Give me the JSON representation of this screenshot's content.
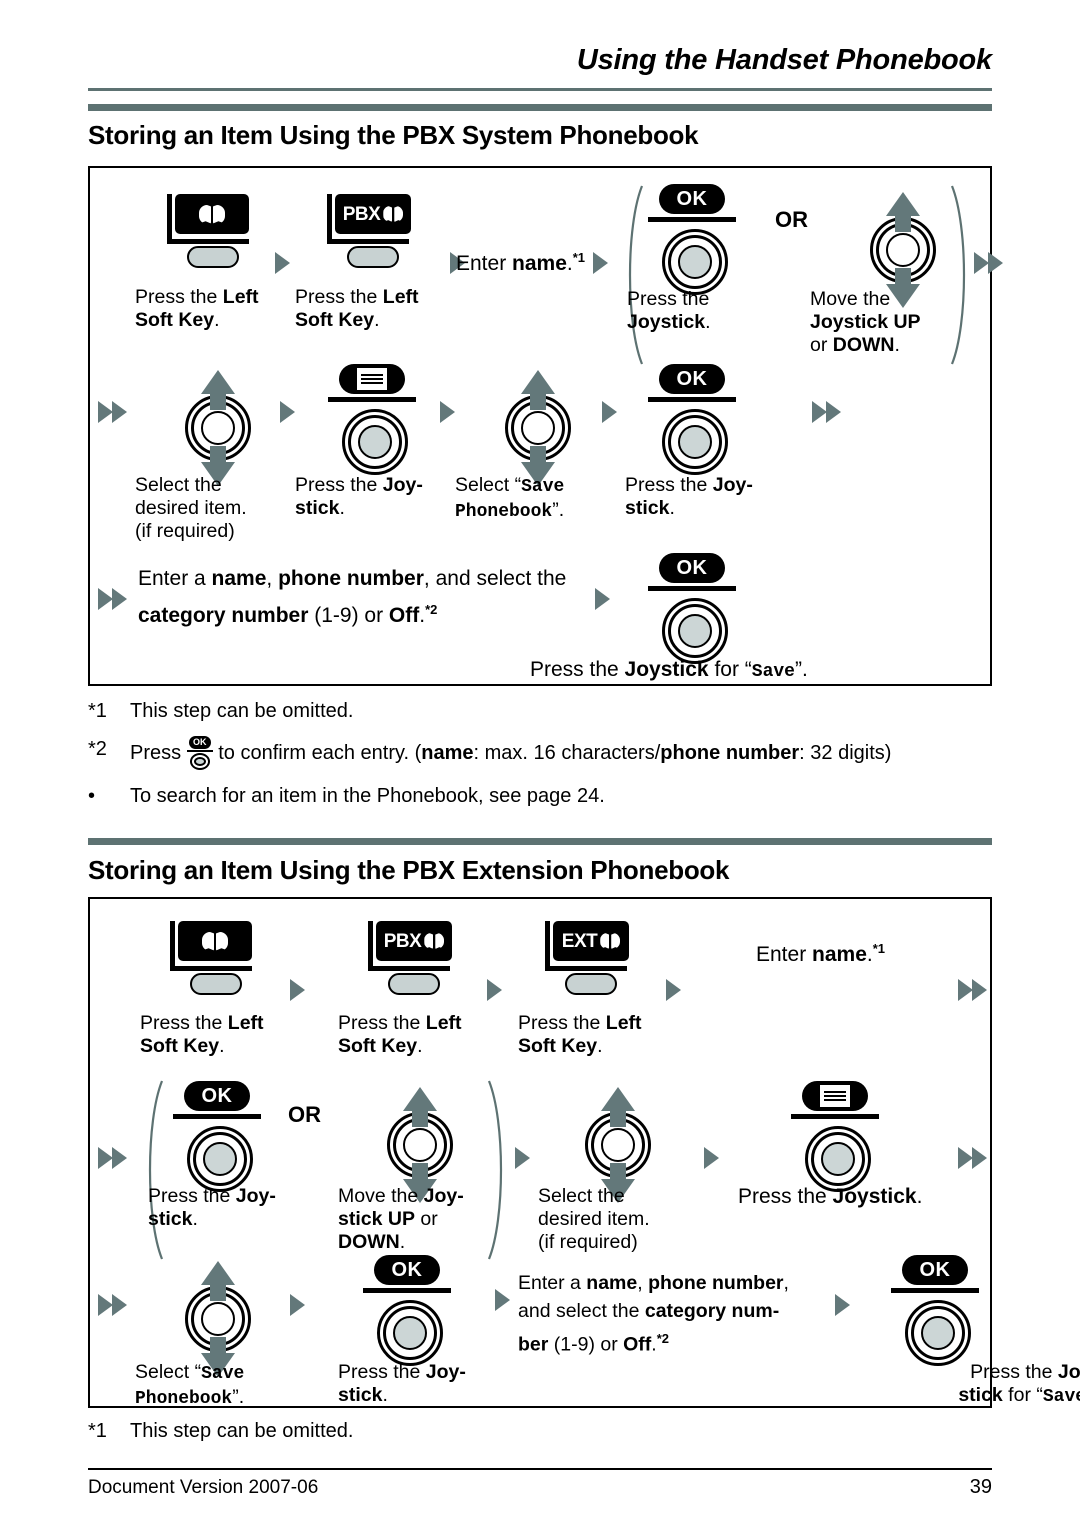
{
  "header": {
    "running_head": "Using the Handset Phonebook"
  },
  "sections": [
    {
      "title": "Storing an Item Using the PBX System Phonebook",
      "steps": [
        {
          "icon": "softkey-phonebook",
          "icon_label": "",
          "caption_html": "Press the <b>Left<br>Soft Key</b>."
        },
        {
          "icon": "softkey-pbx-phonebook",
          "icon_label": "PBX",
          "caption_html": "Press the <b>Left<br>Soft Key</b>."
        },
        {
          "icon": "text",
          "caption_html": "Enter <b>name</b>.<span class=\"sup\">*1</span>"
        },
        {
          "icon": "joystick-ok",
          "caption_html": "Press the<br><b>Joystick</b>."
        },
        {
          "icon": "or-label",
          "caption_html": "OR"
        },
        {
          "icon": "joystick-updown",
          "caption_html": "Move the<br><b>Joystick UP</b><br>or <b>DOWN</b>."
        },
        {
          "icon": "joystick-updown",
          "caption_html": "Select the<br>desired item.<br>(if required)"
        },
        {
          "icon": "joystick-menu",
          "caption_html": "Press the <b>Joy-<br>stick</b>."
        },
        {
          "icon": "joystick-updown",
          "caption_html": "Select “<span class=\"mono\">Save<br>Phonebook</span>”."
        },
        {
          "icon": "joystick-ok",
          "caption_html": "Press the <b>Joy-<br>stick</b>."
        },
        {
          "icon": "text",
          "caption_html": "Enter a <b>name</b>, <b>phone number</b>, and select the<br><b>category number</b> (1-9) or <b>Off</b>.<span class=\"sup\">*2</span>"
        },
        {
          "icon": "joystick-ok",
          "caption_html": "Press the <b>Joystick</b> for “<span class=\"mono\">Save</span>”."
        }
      ],
      "footnotes": [
        {
          "mark": "*1",
          "text": "This step can be omitted."
        },
        {
          "mark": "*2",
          "text_before": "Press ",
          "text_after": " to confirm each entry. (name: max. 16 characters/phone number: 32 digits)"
        },
        {
          "mark": "•",
          "text": "To search for an item in the Phonebook, see page 24."
        }
      ]
    },
    {
      "title": "Storing an Item Using the PBX Extension Phonebook",
      "steps": [
        {
          "icon": "softkey-phonebook",
          "caption_html": "Press the <b>Left<br>Soft Key</b>."
        },
        {
          "icon": "softkey-pbx-phonebook",
          "icon_label": "PBX",
          "caption_html": "Press the <b>Left<br>Soft Key</b>."
        },
        {
          "icon": "softkey-ext-phonebook",
          "icon_label": "EXT",
          "caption_html": "Press the <b>Left<br>Soft Key</b>."
        },
        {
          "icon": "text",
          "caption_html": "Enter <b>name</b>.<span class=\"sup\">*1</span>"
        },
        {
          "icon": "joystick-ok",
          "caption_html": "Press the <b>Joy-<br>stick</b>."
        },
        {
          "icon": "or-label",
          "caption_html": "OR"
        },
        {
          "icon": "joystick-updown",
          "caption_html": "Move the <b>Joy-<br>stick UP</b> or<br><b>DOWN</b>."
        },
        {
          "icon": "joystick-updown",
          "caption_html": "Select the<br>desired item.<br>(if required)"
        },
        {
          "icon": "joystick-menu",
          "caption_html": "Press the <b>Joystick</b>."
        },
        {
          "icon": "joystick-updown",
          "caption_html": "Select “<span class=\"mono\">Save<br>Phonebook</span>”."
        },
        {
          "icon": "joystick-ok",
          "caption_html": "Press the <b>Joy-<br>stick</b>."
        },
        {
          "icon": "text",
          "caption_html": "Enter a <b>name</b>, <b>phone number</b>,<br>and select the <b>category num-<br>ber</b> (1-9) or <b>Off</b>.<span class=\"sup\">*2</span>"
        },
        {
          "icon": "joystick-ok",
          "caption_html": "Press the <b>Joy-<br>stick</b> for “<span class=\"mono\">Save</span>”."
        }
      ],
      "footnotes": [
        {
          "mark": "*1",
          "text": "This step can be omitted."
        }
      ]
    }
  ],
  "labels": {
    "or": "OR",
    "ok": "OK",
    "pbx": "PBX",
    "ext": "EXT",
    "enter_name": "Enter ",
    "name_bold": "name",
    "fn1_mark": "*1",
    "fn2_mark": "*2",
    "bullet_mark": "•"
  },
  "captions": {
    "s1_left_softkey_a": "Press the ",
    "s1_left_softkey_b": "Left",
    "s1_left_softkey_c": "Soft Key",
    "press_joystick": "Press the ",
    "joystick": "Joystick",
    "move_the": "Move the ",
    "joystick_up": "Joystick UP",
    "or_down": "or DOWN",
    "select_the": "Select the",
    "desired_item": "desired item.",
    "if_required": "(if required)",
    "save_phonebook": "Save Phonebook",
    "save": "Save"
  },
  "footer": {
    "version": "Document Version  2007-06",
    "page": "39"
  },
  "colors": {
    "accent_rule": "#5d7272",
    "arrow": "#63787a",
    "key_gray": "#c8d2d2",
    "hub_gray": "#ccd6d6"
  }
}
